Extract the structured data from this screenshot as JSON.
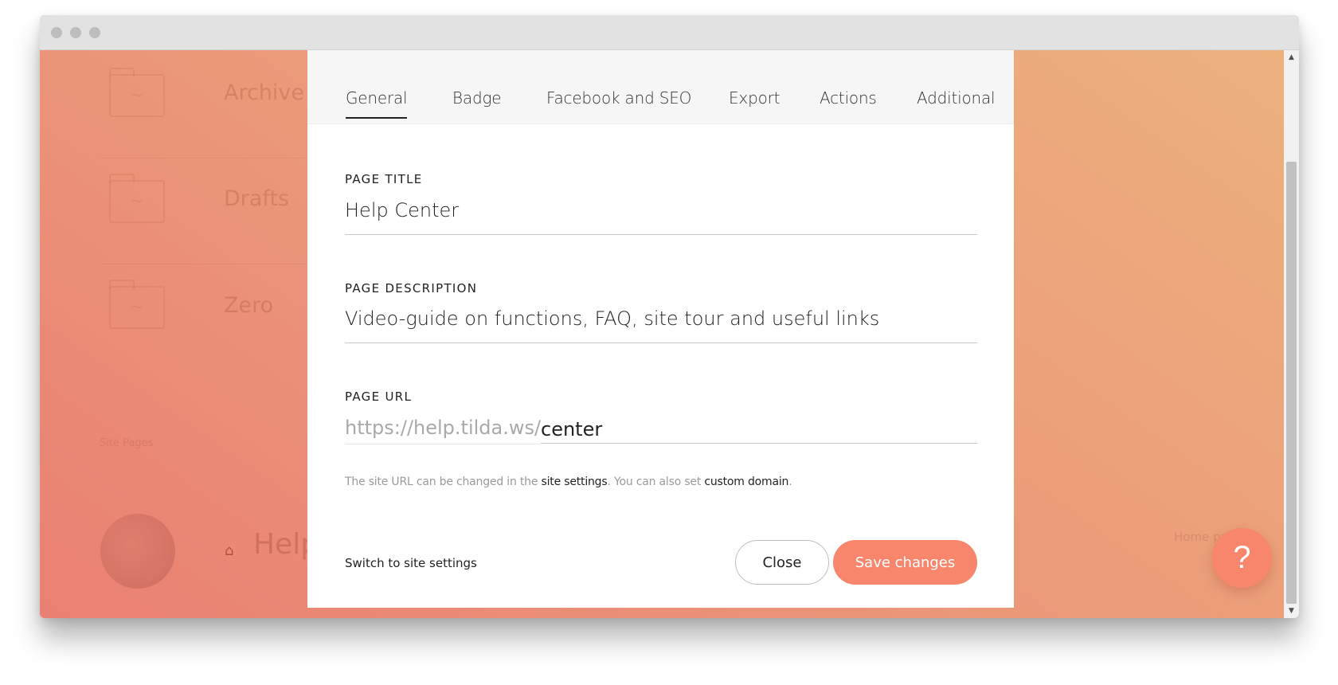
{
  "background": {
    "folders": [
      {
        "label": "Archive"
      },
      {
        "label": "Drafts"
      },
      {
        "label": "Zero"
      }
    ],
    "site_pages_label": "Site Pages",
    "page_name": "Help",
    "home_page_label": "Home pa",
    "folder_glyph": "~"
  },
  "help_button": {
    "label": "?"
  },
  "modal": {
    "tabs": [
      {
        "label": "General",
        "active": true
      },
      {
        "label": "Badge"
      },
      {
        "label": "Facebook and SEO"
      },
      {
        "label": "Export"
      },
      {
        "label": "Actions"
      },
      {
        "label": "Additional"
      }
    ],
    "page_title": {
      "label": "PAGE TITLE",
      "value": "Help Center"
    },
    "page_description": {
      "label": "PAGE DESCRIPTION",
      "value": "Video-guide on functions, FAQ, site tour  and useful links"
    },
    "page_url": {
      "label": "PAGE URL",
      "prefix": "https://help.tilda.ws/",
      "value": "center"
    },
    "hint": {
      "part1": "The site URL can be changed in the ",
      "link1": "site settings",
      "part2": ". You can also set ",
      "link2": "custom domain",
      "part3": "."
    },
    "switch_link": "Switch to site settings",
    "close_label": "Close",
    "save_label": "Save changes"
  },
  "colors": {
    "accent": "#f7866c",
    "bg_gradient_start": "#ea8073",
    "bg_gradient_end": "#edb17e"
  }
}
